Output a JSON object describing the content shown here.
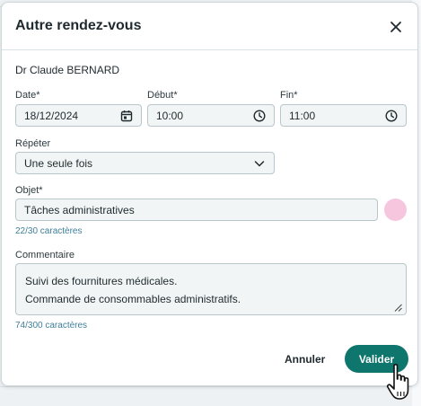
{
  "dialog": {
    "title": "Autre rendez-vous",
    "practitioner": "Dr Claude BERNARD"
  },
  "date": {
    "label": "Date*",
    "value": "18/12/2024"
  },
  "start": {
    "label": "Début*",
    "value": "10:00"
  },
  "end": {
    "label": "Fin*",
    "value": "11:00"
  },
  "repeat": {
    "label": "Répéter",
    "value": "Une seule fois"
  },
  "subject": {
    "label": "Objet*",
    "value": "Tâches administratives",
    "counter": "22/30 caractères",
    "color": "#f6c6de"
  },
  "comment": {
    "label": "Commentaire",
    "lines": [
      "Suivi des fournitures médicales.",
      "Commande de consommables administratifs."
    ],
    "counter": "74/300 caractères"
  },
  "actions": {
    "cancel": "Annuler",
    "submit": "Valider"
  },
  "colors": {
    "primary": "#0f766e",
    "counter_text": "#3f7f9a"
  }
}
